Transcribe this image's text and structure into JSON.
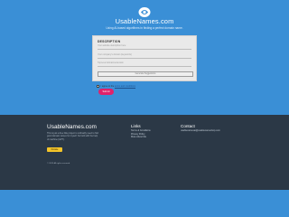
{
  "hero": {
    "site_title": "UsableNames.com",
    "tagline": "Using AI-based algorithms in finding a perfect domain name."
  },
  "form": {
    "heading": "DESCRIPTION",
    "fields": [
      "Your website description here",
      "Your company's domain (keywords)",
      "Top-level domain/extension"
    ],
    "generate_label": "Generate Suggestions",
    "agree_prefix": "I agree to the",
    "agree_link": "terms and conditions",
    "submit_label": "Submit"
  },
  "footer": {
    "brand": "UsableNames.com",
    "description": "This is just a free little project to ordinarily need to find good domain names for myself. So built with the help of machine (GPT).",
    "donate_label": "Donate",
    "copyright": "© 2023 All rights reserved.",
    "links_heading": "Links",
    "links": [
      "Terms & Conditions",
      "Privacy Policy",
      "More About Me"
    ],
    "contact_heading": "Contact",
    "contact_email": "usablenamesai@usablenameshop.com"
  }
}
